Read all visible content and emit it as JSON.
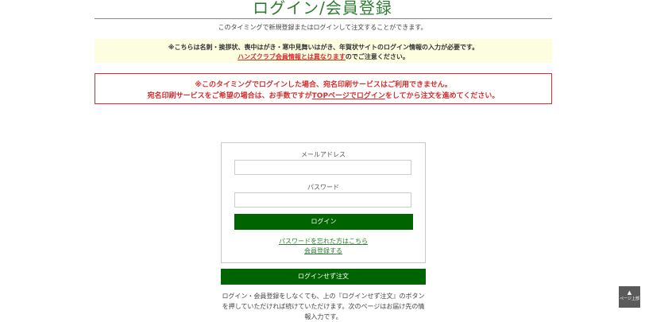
{
  "page": {
    "title": "ログイン/会員登録",
    "intro": "このタイミングで新規登録またはログインして注文することができます。"
  },
  "notice_yellow": {
    "line1": "※こちらは名刺・挨拶状、喪中はがき・寒中見舞いはがき、年賀状サイトのログイン情報の入力が必要です。",
    "line2_link": "ハンズクラブ会員情報とは異なります",
    "line2_rest": "のでご注意ください。"
  },
  "notice_red": {
    "line1": "※このタイミングでログインした場合、宛名印刷サービスはご利用できません。",
    "line2_before": "宛名印刷サービスをご希望の場合は、お手数ですが",
    "line2_link": "TOPページでログイン",
    "line2_after": "をしてから注文を進めてください。"
  },
  "login": {
    "email_label": "メールアドレス",
    "email_value": "",
    "email_placeholder": "",
    "password_label": "パスワード",
    "password_value": "",
    "password_placeholder": "",
    "login_button": "ログイン",
    "forgot_password_link": "パスワードを忘れた方はこちら",
    "register_link": "会員登録する"
  },
  "guest": {
    "button": "ログインせず注文",
    "note": "ログイン・会員登録をしなくても、上の『ログインせず注文』のボタンを押していただければ続けていただけます。次のページはお届け先の情報入力です。"
  },
  "page_top": {
    "icon": "up-arrow-icon",
    "label": "ページ上部"
  },
  "colors": {
    "title_green": "#2f7d32",
    "button_green": "#006400",
    "alert_red": "#d32f2f",
    "notice_yellow_bg": "#fdfde0"
  }
}
